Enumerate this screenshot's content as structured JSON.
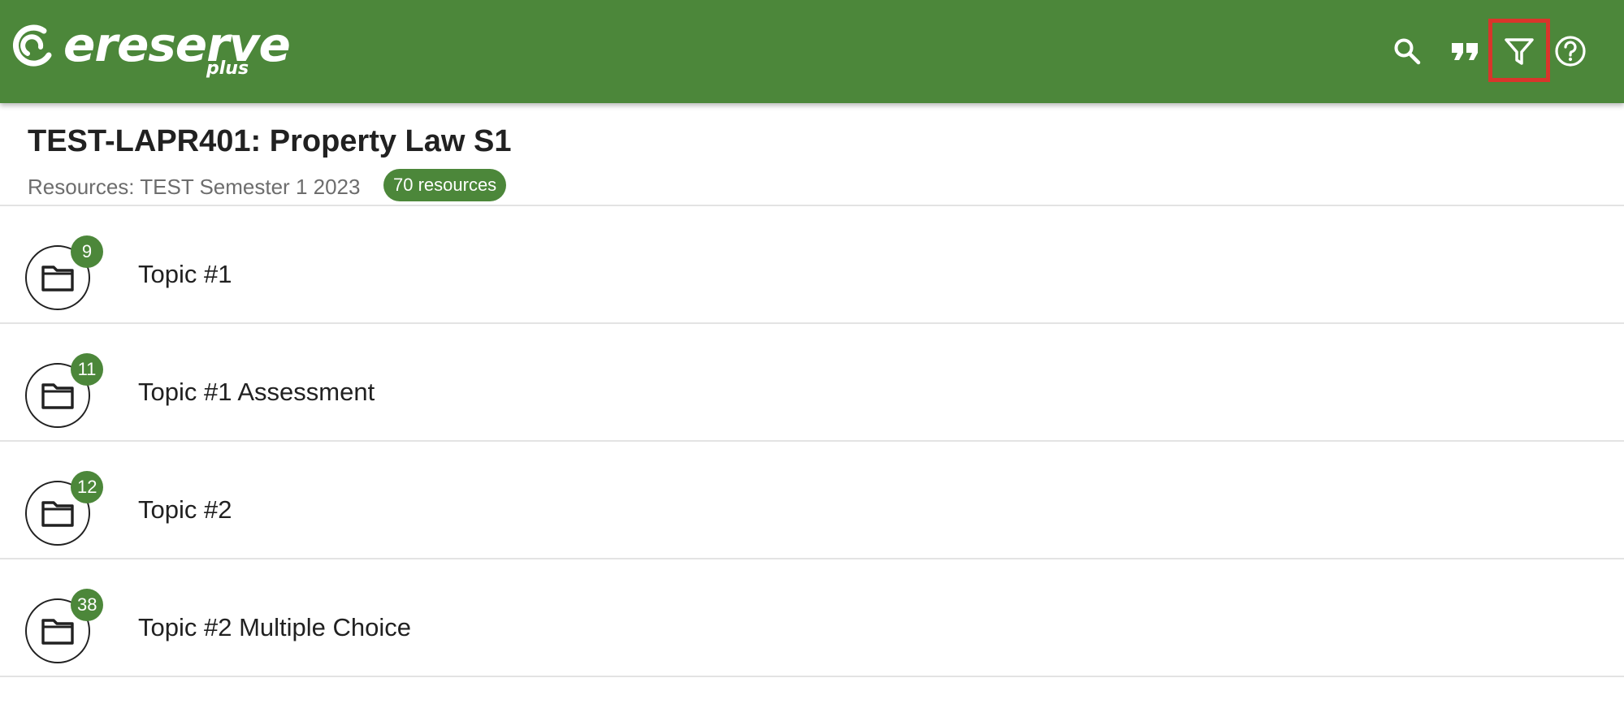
{
  "app": {
    "brand_name": "ereserve",
    "brand_sub": "plus",
    "brand_color": "#4c873a"
  },
  "toolbar": {
    "icons": [
      "search-icon",
      "quote-icon",
      "filter-icon",
      "help-icon"
    ],
    "highlight_color": "#d9352b"
  },
  "course": {
    "title": "TEST-LAPR401: Property Law S1",
    "subtitle": "Resources: TEST Semester 1 2023",
    "resource_count_label": "70 resources"
  },
  "topics": [
    {
      "label": "Topic #1",
      "count": "9",
      "icon": "folder-icon"
    },
    {
      "label": "Topic #1 Assessment",
      "count": "11",
      "icon": "folder-icon"
    },
    {
      "label": "Topic #2",
      "count": "12",
      "icon": "folder-icon"
    },
    {
      "label": "Topic #2 Multiple Choice",
      "count": "38",
      "icon": "folder-icon"
    }
  ]
}
